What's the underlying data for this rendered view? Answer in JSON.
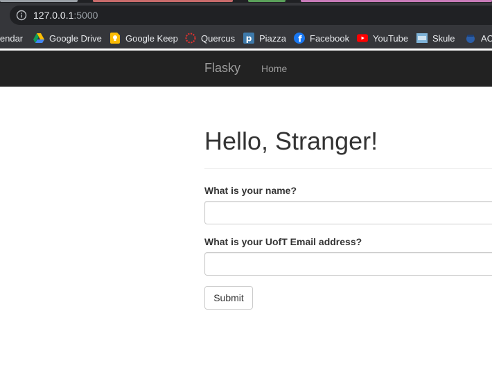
{
  "browser": {
    "url_host": "127.0.0.1",
    "url_port": ":5000",
    "bookmarks": [
      {
        "label": "lendar",
        "icon": "calendar-icon"
      },
      {
        "label": "Google Drive",
        "icon": "google-drive-icon"
      },
      {
        "label": "Google Keep",
        "icon": "google-keep-icon"
      },
      {
        "label": "Quercus",
        "icon": "quercus-icon"
      },
      {
        "label": "Piazza",
        "icon": "piazza-icon"
      },
      {
        "label": "Facebook",
        "icon": "facebook-icon"
      },
      {
        "label": "YouTube",
        "icon": "youtube-icon"
      },
      {
        "label": "Skule",
        "icon": "skule-icon"
      },
      {
        "label": "AC",
        "icon": "acorn-icon"
      }
    ]
  },
  "navbar": {
    "brand": "Flasky",
    "home_label": "Home"
  },
  "main": {
    "heading": "Hello, Stranger!",
    "form": {
      "name_label": "What is your name?",
      "name_value": "",
      "email_label": "What is your UofT Email address?",
      "email_value": "",
      "submit_label": "Submit"
    }
  },
  "colors": {
    "chrome_bg": "#35363a",
    "omnibox_bg": "#202124",
    "navbar_bg": "#222222",
    "navbar_text": "#9d9d9d",
    "text": "#333333"
  }
}
